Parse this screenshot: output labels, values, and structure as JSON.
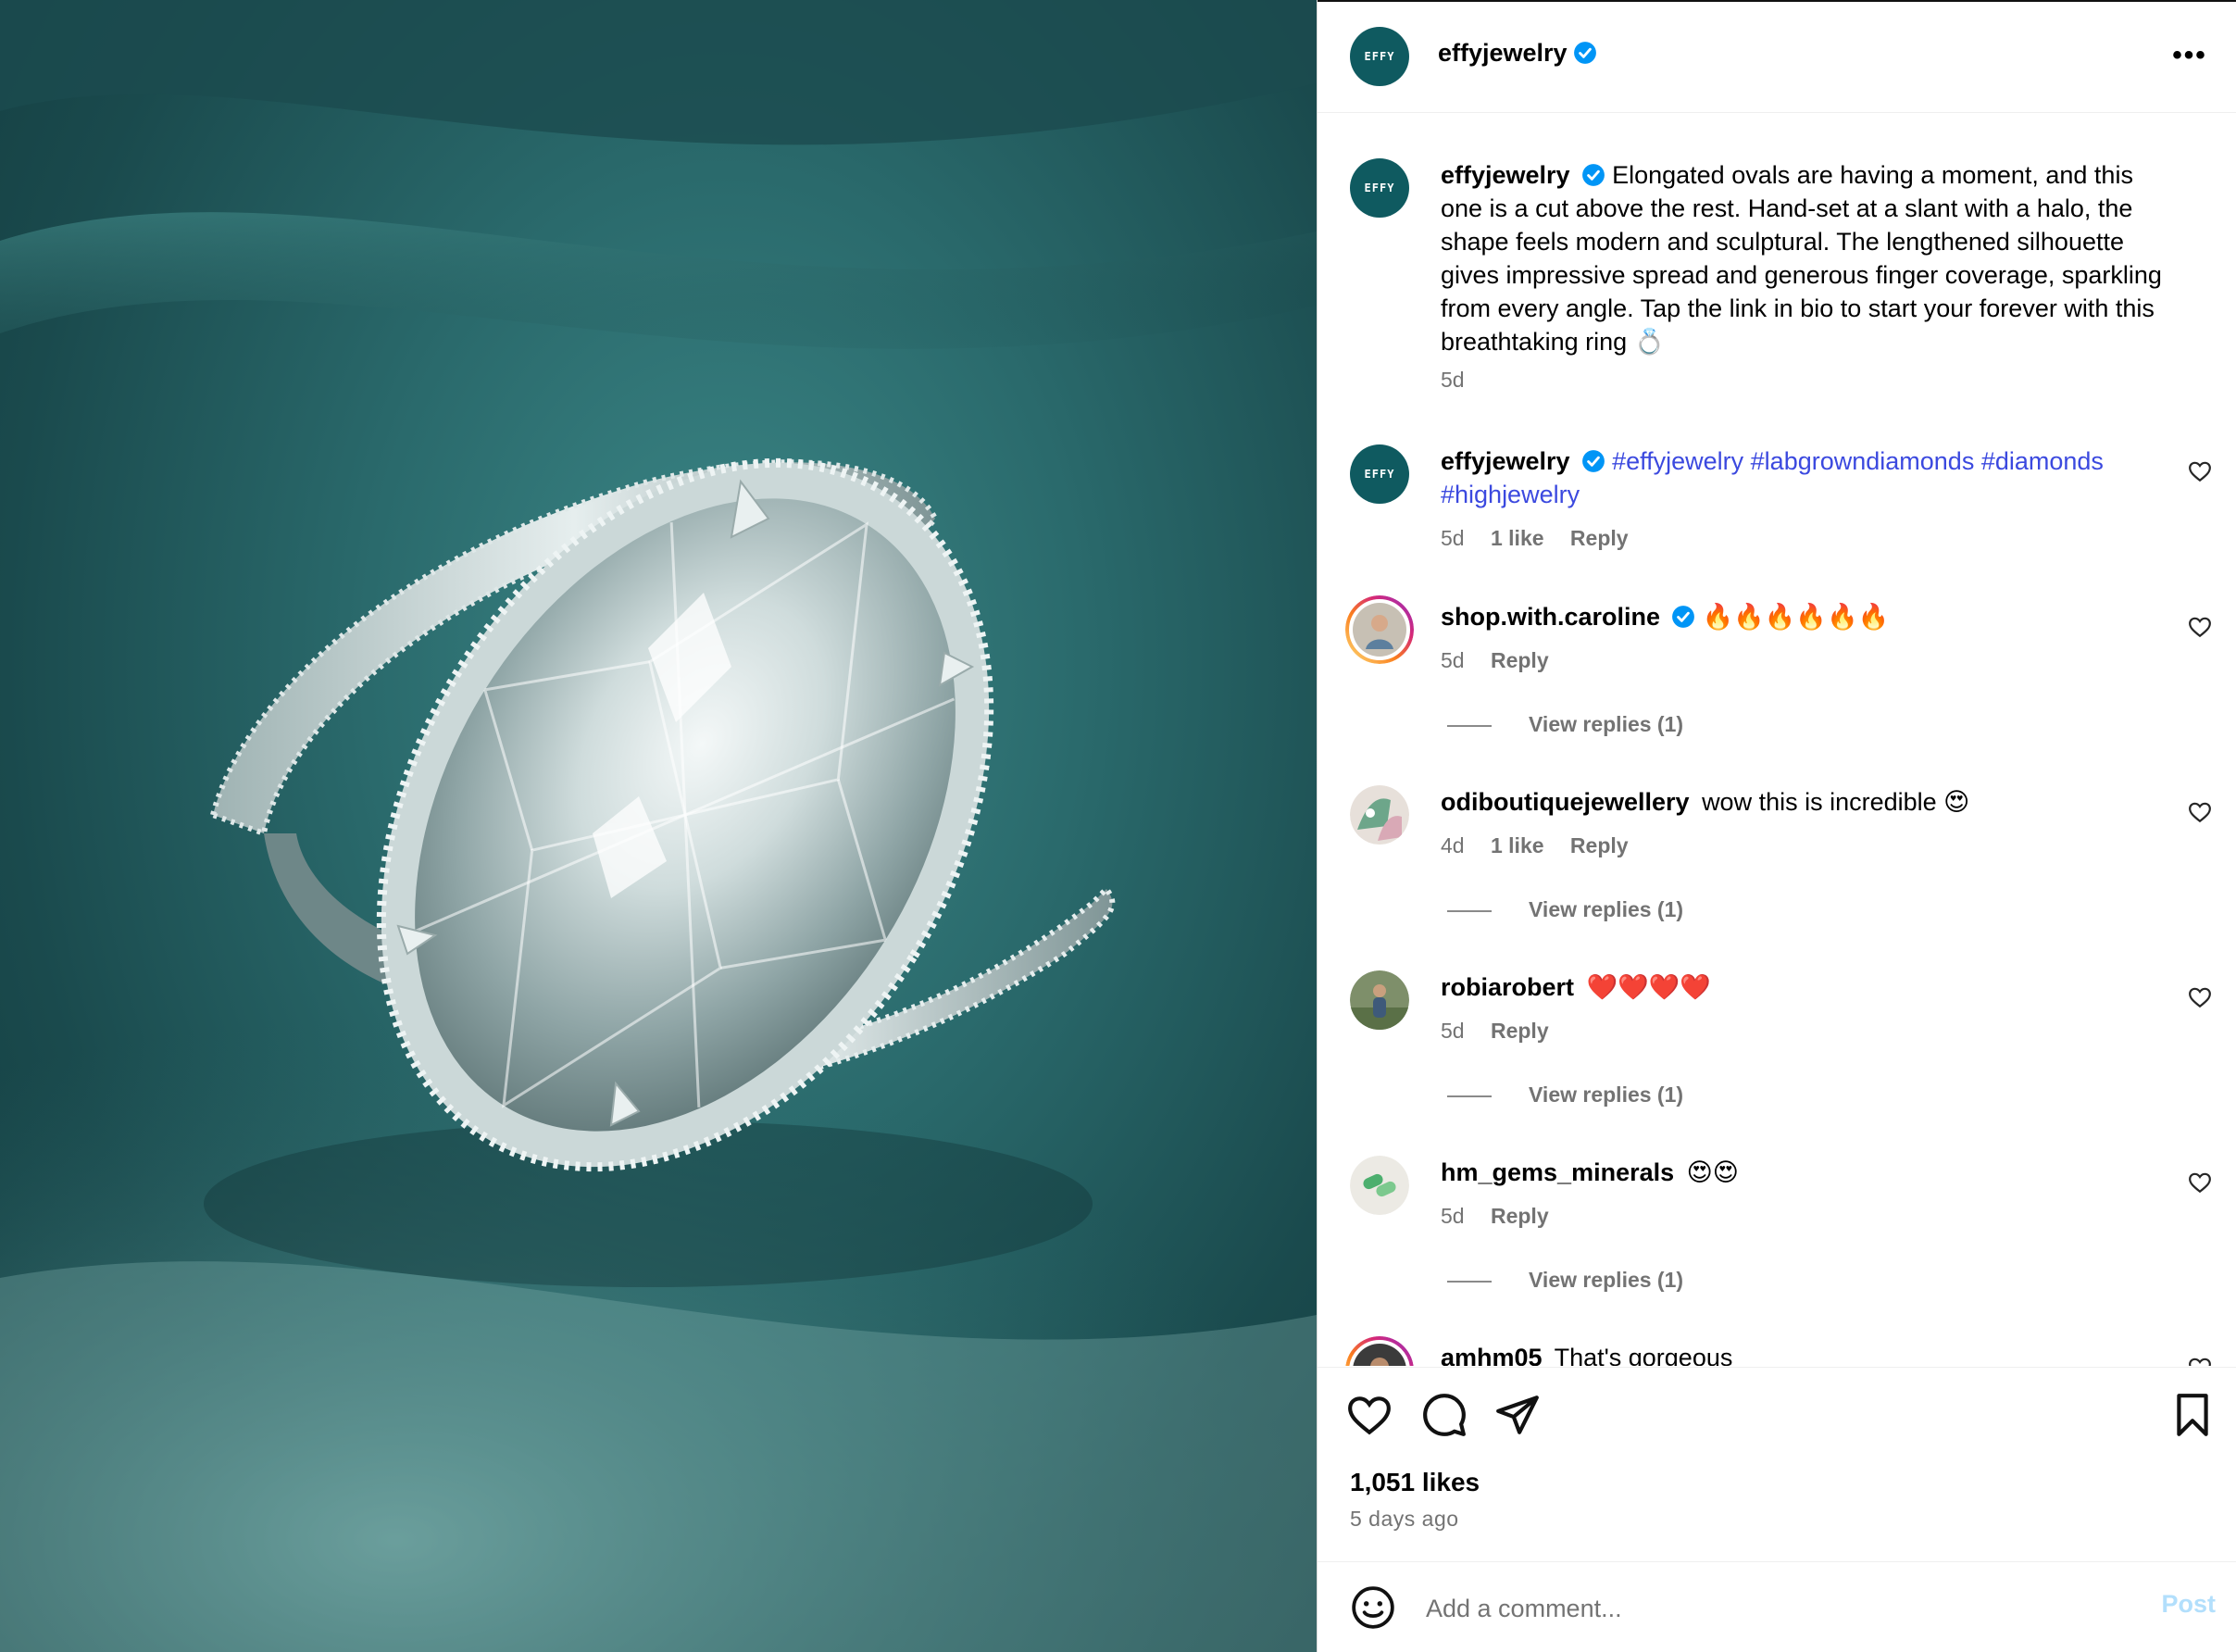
{
  "post": {
    "account": "effyjewelry",
    "brand_mark": "EFFY",
    "more_label": "•••",
    "caption": "Elongated ovals are having a moment, and this one is a cut above the rest. Hand-set at a slant with a halo, the shape feels modern and sculptural. The lengthened silhouette gives impressive spread and generous finger coverage, sparkling from every angle. Tap the link in bio to start your forever with this breathtaking ring 💍",
    "caption_age": "5d"
  },
  "comments": [
    {
      "user": "effyjewelry",
      "text": "#effyjewelry #labgrowndiamonds #diamonds #highjewelry",
      "age": "5d",
      "likes": "1 like",
      "reply": "Reply"
    },
    {
      "user": "shop.with.caroline",
      "text": "🔥🔥🔥🔥🔥🔥",
      "age": "5d",
      "reply": "Reply",
      "view_replies": "View replies (1)"
    },
    {
      "user": "odiboutiquejewellery",
      "text": "wow this is incredible 😍",
      "age": "4d",
      "likes": "1 like",
      "reply": "Reply",
      "view_replies": "View replies (1)"
    },
    {
      "user": "robiarobert",
      "text": "❤️❤️❤️❤️",
      "age": "5d",
      "reply": "Reply",
      "view_replies": "View replies (1)"
    },
    {
      "user": "hm_gems_minerals",
      "text": "😍😍",
      "age": "5d",
      "reply": "Reply",
      "view_replies": "View replies (1)"
    },
    {
      "user": "amhm05",
      "text": "That's gorgeous"
    }
  ],
  "actions": {
    "likes": "1,051 likes",
    "time_ago": "5 days ago"
  },
  "input": {
    "placeholder": "Add a comment...",
    "post_label": "Post"
  },
  "colors": {
    "brand_avatar": "#0f5a60",
    "hashtag": "#3b49df",
    "verified": "#0095f6",
    "post_disabled": "#b2dffc",
    "photo_background": "#2a6a6c"
  },
  "icons": [
    "heart-icon",
    "comment-icon",
    "share-icon",
    "bookmark-icon",
    "emoji-icon",
    "verified-badge-icon",
    "more-options-icon"
  ]
}
